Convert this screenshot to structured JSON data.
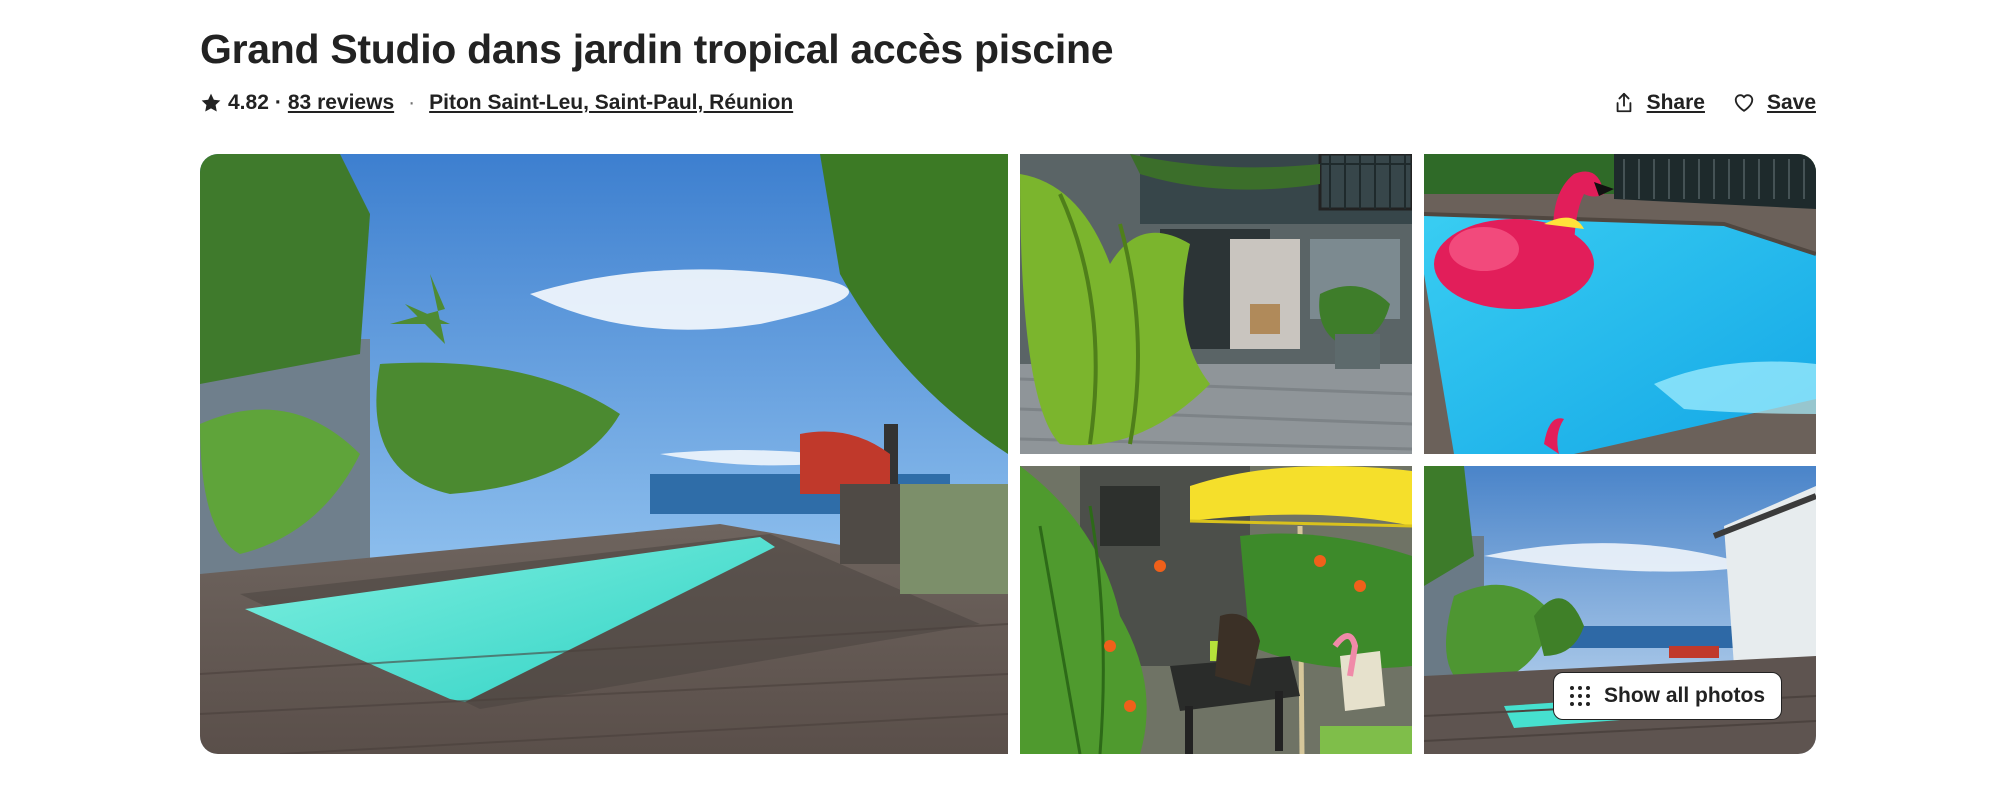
{
  "listing": {
    "title": "Grand Studio dans jardin tropical accès piscine",
    "rating": "4.82",
    "separator": "·",
    "reviews_label": "83 reviews",
    "bullet": "·",
    "location": "Piton Saint-Leu, Saint-Paul, Réunion"
  },
  "actions": {
    "share_label": "Share",
    "save_label": "Save"
  },
  "gallery": {
    "show_all_label": "Show all photos",
    "photos": [
      {
        "subject": "pool-deck-ocean-view"
      },
      {
        "subject": "studio-entrance-plants"
      },
      {
        "subject": "pool-flamingo-float"
      },
      {
        "subject": "garden-terrace-yellow-umbrella"
      },
      {
        "subject": "pool-deck-wide-view"
      }
    ]
  },
  "icons": {
    "star": "star-icon",
    "share": "share-icon",
    "save": "heart-icon",
    "grid": "grid-dots-icon"
  },
  "colors": {
    "text": "#222222",
    "secondary": "#717171"
  }
}
